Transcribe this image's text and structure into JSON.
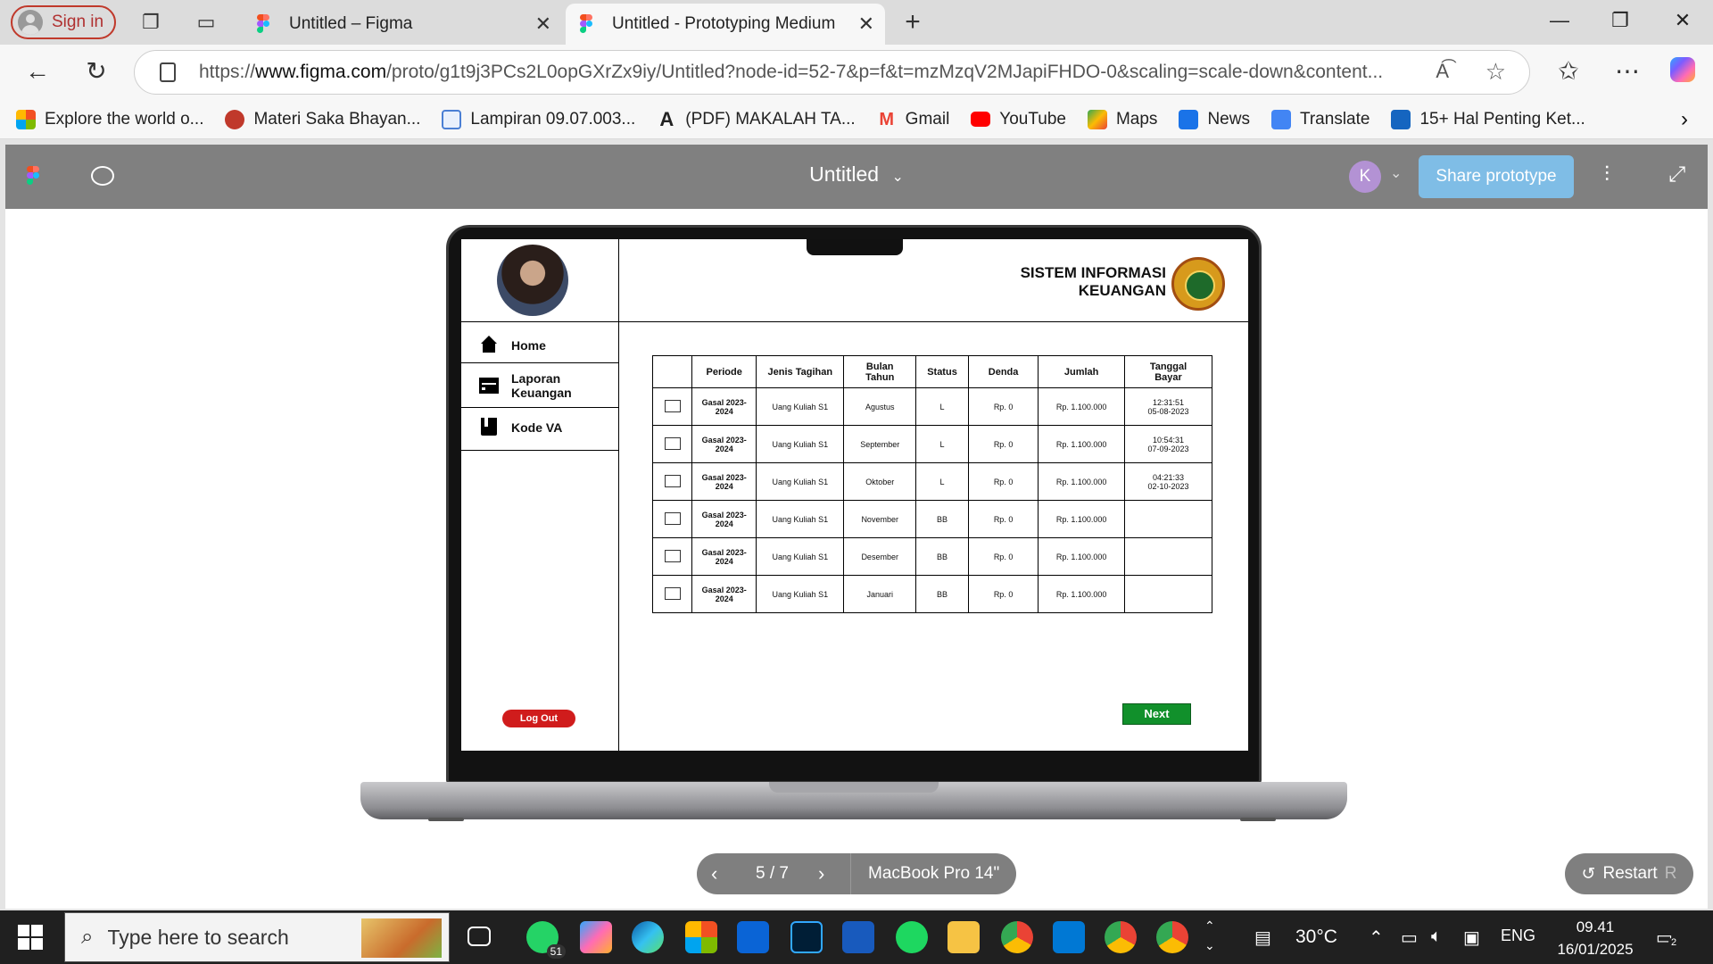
{
  "browser": {
    "signin_label": "Sign in",
    "tabs": [
      {
        "title": "Untitled – Figma"
      },
      {
        "title": "Untitled - Prototyping Medium"
      }
    ],
    "url_prefix": "https://",
    "url_domain": "www.figma.com",
    "url_rest": "/proto/g1t9j3PCs2L0opGXrZx9iy/Untitled?node-id=52-7&p=f&t=mzMzqV2MJapiFHDO-0&scaling=scale-down&content..."
  },
  "bookmarks": [
    {
      "label": "Explore the world o...",
      "color": "#f25022"
    },
    {
      "label": "Materi Saka Bhayan...",
      "color": "#c0392b"
    },
    {
      "label": "Lampiran 09.07.003...",
      "color": "#4a7fd4"
    },
    {
      "label": "(PDF) MAKALAH TA...",
      "color": "#111111"
    },
    {
      "label": "Gmail",
      "color": "#ea4335"
    },
    {
      "label": "YouTube",
      "color": "#ff0000"
    },
    {
      "label": "Maps",
      "color": "#34a853"
    },
    {
      "label": "News",
      "color": "#1a73e8"
    },
    {
      "label": "Translate",
      "color": "#4285f4"
    },
    {
      "label": "15+ Hal Penting Ket...",
      "color": "#1565c0"
    }
  ],
  "figma": {
    "file_title": "Untitled",
    "avatar_letter": "K",
    "share_label": "Share prototype",
    "page_indicator": "5 / 7",
    "device_label": "MacBook Pro 14\"",
    "restart_label": "Restart",
    "restart_key": "R"
  },
  "app": {
    "header_line1": "SISTEM INFORMASI",
    "header_line2": "KEUANGAN",
    "menu": [
      {
        "label": "Home"
      },
      {
        "label": "Laporan Keuangan"
      },
      {
        "label": "Kode VA"
      }
    ],
    "logout_label": "Log Out",
    "next_label": "Next",
    "table": {
      "headers": [
        "",
        "Periode",
        "Jenis Tagihan",
        "Bulan Tahun",
        "Status",
        "Denda",
        "Jumlah",
        "Tanggal Bayar"
      ],
      "rows": [
        {
          "periode": "Gasal 2023-2024",
          "jenis": "Uang Kuliah S1",
          "bulan": "Agustus",
          "status": "L",
          "denda": "Rp. 0",
          "jumlah": "Rp. 1.100.000",
          "time": "12:31:51",
          "date": "05-08-2023"
        },
        {
          "periode": "Gasal 2023-2024",
          "jenis": "Uang Kuliah S1",
          "bulan": "September",
          "status": "L",
          "denda": "Rp. 0",
          "jumlah": "Rp. 1.100.000",
          "time": "10:54:31",
          "date": "07-09-2023"
        },
        {
          "periode": "Gasal 2023-2024",
          "jenis": "Uang Kuliah S1",
          "bulan": "Oktober",
          "status": "L",
          "denda": "Rp. 0",
          "jumlah": "Rp. 1.100.000",
          "time": "04:21:33",
          "date": "02-10-2023"
        },
        {
          "periode": "Gasal 2023-2024",
          "jenis": "Uang Kuliah S1",
          "bulan": "November",
          "status": "BB",
          "denda": "Rp. 0",
          "jumlah": "Rp. 1.100.000",
          "time": "",
          "date": ""
        },
        {
          "periode": "Gasal 2023-2024",
          "jenis": "Uang Kuliah S1",
          "bulan": "Desember",
          "status": "BB",
          "denda": "Rp. 0",
          "jumlah": "Rp. 1.100.000",
          "time": "",
          "date": ""
        },
        {
          "periode": "Gasal 2023-2024",
          "jenis": "Uang Kuliah S1",
          "bulan": "Januari",
          "status": "BB",
          "denda": "Rp. 0",
          "jumlah": "Rp. 1.100.000",
          "time": "",
          "date": ""
        }
      ]
    }
  },
  "taskbar": {
    "search_placeholder": "Type here to search",
    "whatsapp_badge": "51",
    "temperature": "30°C",
    "language": "ENG",
    "time": "09.41",
    "date": "16/01/2025",
    "notification_count": "2"
  }
}
